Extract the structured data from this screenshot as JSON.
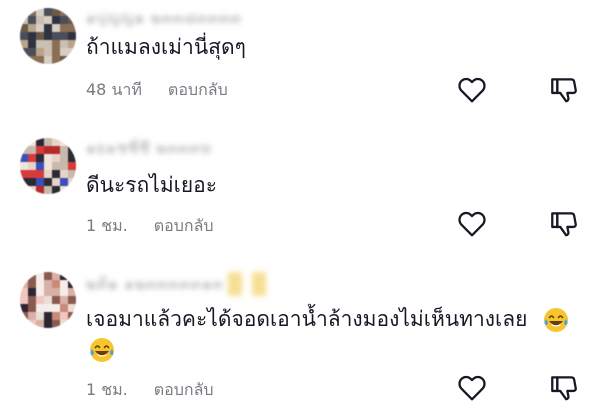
{
  "comments": [
    {
      "username_blurred": "๑บุ่ญญ๑ ๒๓๓๘๓๓๓๓",
      "text": "ถ้าแมลงเม่านี่สุดๆ",
      "timestamp": "48 นาที",
      "reply_label": "ตอบกลับ",
      "avatar_palette": [
        "#b9a38a",
        "#8a6f55",
        "#4a4f5a",
        "#c9bfb2",
        "#6b5a4a",
        "#2f3340",
        "#d8cfc4"
      ]
    },
    {
      "username_blurred": "๑ย๑ชซี่ซี ๒๓๓๓ษ",
      "text": "ดีนะรถไม่เยอะ",
      "timestamp": "1 ชม.",
      "reply_label": "ตอบกลับ",
      "avatar_palette": [
        "#c8b9ad",
        "#d63a3a",
        "#f1e4dc",
        "#2a2a35",
        "#3b4fb8",
        "#e8d3c9",
        "#b52b2b"
      ]
    },
    {
      "username_blurred": "๒๓ี๑ ๑๒๓๓๓๓๓๑๓",
      "text": "เจอมาแล้วคะได้จอดเอาน้ำล้างมองไม่เห็นทางเลย",
      "timestamp": "1 ชม.",
      "reply_label": "ตอบกลับ",
      "avatar_palette": [
        "#e9dfd6",
        "#c98a7a",
        "#2b2730",
        "#f0c6bf",
        "#8a5a50",
        "#d9b0a8",
        "#f6ecea"
      ]
    }
  ],
  "icons": {
    "like": "heart-outline-icon",
    "dislike": "thumbs-down-outline-icon",
    "emoji": "laughing-tears-emoji"
  },
  "colors": {
    "text": "#161823",
    "meta": "#7a7b82",
    "icon": "#161823"
  }
}
